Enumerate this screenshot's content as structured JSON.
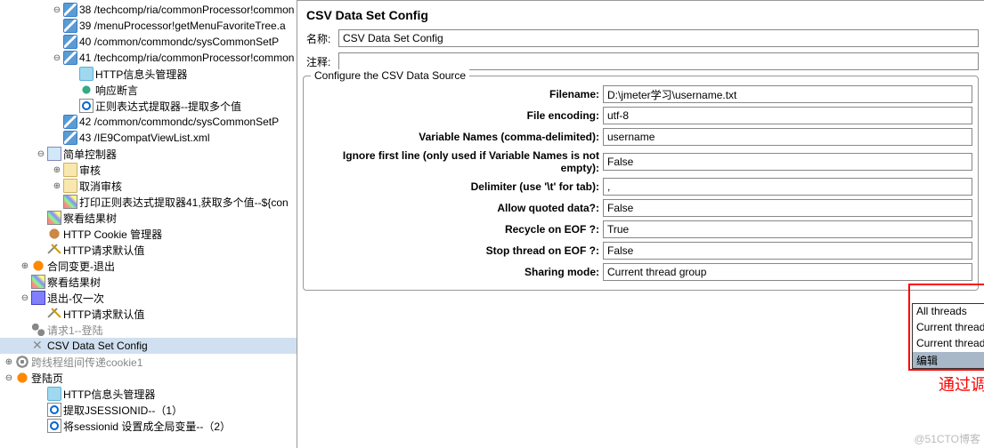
{
  "tree": [
    {
      "indent": 3,
      "toggle": "⊖",
      "icon": "sampler-icon",
      "label": "38 /techcomp/ria/commonProcessor!common"
    },
    {
      "indent": 3,
      "toggle": "",
      "icon": "sampler-icon",
      "label": "39 /menuProcessor!getMenuFavoriteTree.a"
    },
    {
      "indent": 3,
      "toggle": "",
      "icon": "sampler-icon",
      "label": "40 /common/commondc/sysCommonSetP"
    },
    {
      "indent": 3,
      "toggle": "⊖",
      "icon": "sampler-icon",
      "label": "41 /techcomp/ria/commonProcessor!common"
    },
    {
      "indent": 4,
      "toggle": "",
      "icon": "header-icon",
      "label": "HTTP信息头管理器"
    },
    {
      "indent": 4,
      "toggle": "",
      "icon": "assert-icon",
      "label": "响应断言"
    },
    {
      "indent": 4,
      "toggle": "",
      "icon": "extract-icon",
      "label": "正则表达式提取器--提取多个值"
    },
    {
      "indent": 3,
      "toggle": "",
      "icon": "sampler-icon",
      "label": "42 /common/commondc/sysCommonSetP"
    },
    {
      "indent": 3,
      "toggle": "",
      "icon": "sampler-icon",
      "label": "43 /IE9CompatViewList.xml"
    },
    {
      "indent": 2,
      "toggle": "⊖",
      "icon": "controller-icon",
      "label": "简单控制器"
    },
    {
      "indent": 3,
      "toggle": "⊕",
      "icon": "folder-icon",
      "label": "审核"
    },
    {
      "indent": 3,
      "toggle": "⊕",
      "icon": "folder-icon",
      "label": "取消审核"
    },
    {
      "indent": 3,
      "toggle": "",
      "icon": "listener-icon",
      "label": "打印正则表达式提取器41,获取多个值--${con"
    },
    {
      "indent": 2,
      "toggle": "",
      "icon": "listener-icon",
      "label": "察看结果树"
    },
    {
      "indent": 2,
      "toggle": "",
      "icon": "cookie-icon",
      "label": "HTTP Cookie 管理器"
    },
    {
      "indent": 2,
      "toggle": "",
      "icon": "config-icon",
      "label": "HTTP请求默认值"
    },
    {
      "indent": 1,
      "toggle": "⊕",
      "icon": "badge-icon",
      "label": "合同变更-退出"
    },
    {
      "indent": 1,
      "toggle": "",
      "icon": "listener-icon",
      "label": "察看结果树"
    },
    {
      "indent": 1,
      "toggle": "⊖",
      "icon": "once-icon",
      "label": "退出-仅一次"
    },
    {
      "indent": 2,
      "toggle": "",
      "icon": "config-icon",
      "label": "HTTP请求默认值"
    },
    {
      "indent": 1,
      "toggle": "",
      "icon": "threadgroup-icon",
      "label": "请求1--登陆",
      "disabled": true
    },
    {
      "indent": 1,
      "toggle": "",
      "icon": "csv-icon",
      "label": "CSV Data Set Config",
      "selected": true
    },
    {
      "indent": 0,
      "toggle": "⊕",
      "icon": "gear-icon",
      "label": "跨线程组间传递cookie1",
      "disabled": true
    },
    {
      "indent": 0,
      "toggle": "⊖",
      "icon": "badge-icon",
      "label": "登陆页"
    },
    {
      "indent": 2,
      "toggle": "",
      "icon": "header-icon",
      "label": "HTTP信息头管理器"
    },
    {
      "indent": 2,
      "toggle": "",
      "icon": "extract-icon",
      "label": "提取JSESSIONID--（1）"
    },
    {
      "indent": 2,
      "toggle": "",
      "icon": "extract-icon",
      "label": "将sessionid 设置成全局变量--（2）"
    }
  ],
  "panel": {
    "title": "CSV Data Set Config",
    "nameLabel": "名称:",
    "nameValue": "CSV Data Set Config",
    "commentLabel": "注释:",
    "commentValue": "",
    "fieldsetTitle": "Configure the CSV Data Source",
    "fields": {
      "filename": {
        "label": "Filename:",
        "value": "D:\\jmeter学习\\username.txt"
      },
      "encoding": {
        "label": "File encoding:",
        "value": "utf-8"
      },
      "varnames": {
        "label": "Variable Names (comma-delimited):",
        "value": "username"
      },
      "ignore": {
        "label": "Ignore first line (only used if Variable Names is not empty):",
        "value": "False"
      },
      "delimiter": {
        "label": "Delimiter (use '\\t' for tab):",
        "value": ","
      },
      "quoted": {
        "label": "Allow quoted data?:",
        "value": "False"
      },
      "recycle": {
        "label": "Recycle on EOF ?:",
        "value": "True"
      },
      "stop": {
        "label": "Stop thread on EOF ?:",
        "value": "False"
      },
      "sharing": {
        "label": "Sharing mode:",
        "value": "Current thread group"
      }
    },
    "dropdownOptions": [
      "All threads",
      "Current thread group",
      "Current thread",
      "编辑"
    ]
  },
  "annotation": "通过调整这里，可以改变取参数的顺序。",
  "watermark": "@51CTO博客"
}
